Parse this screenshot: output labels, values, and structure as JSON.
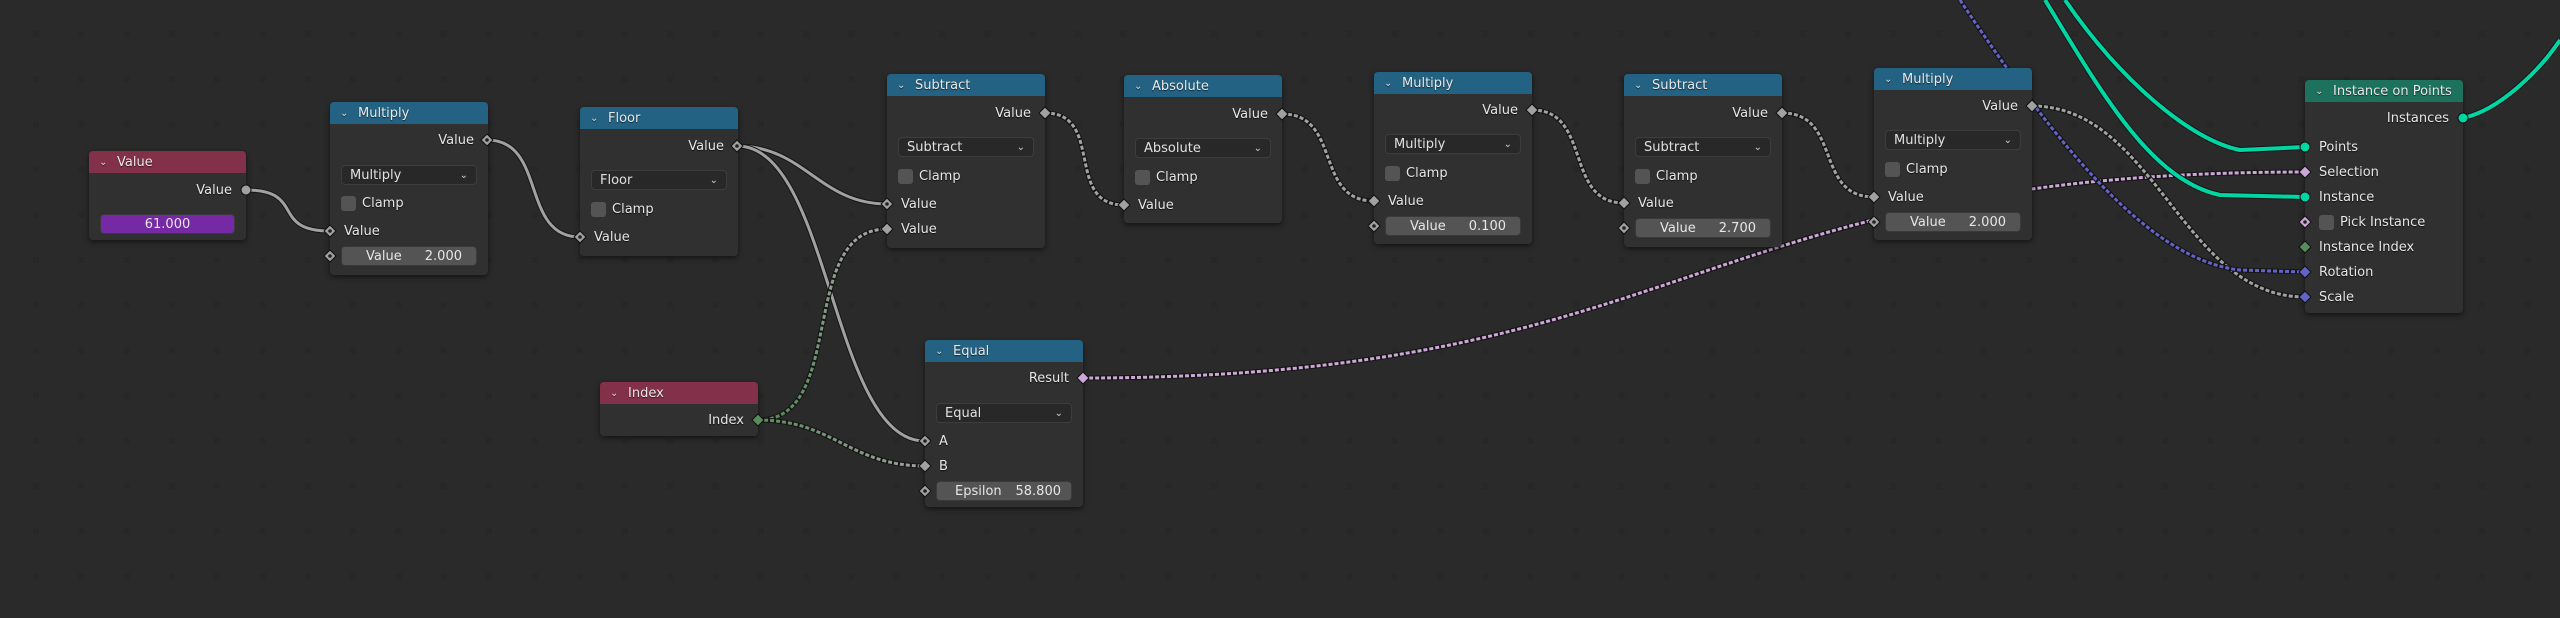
{
  "editor": "Geometry Node Editor",
  "colors": {
    "background": "#1d1d1d",
    "node_body": "#303030",
    "header_input": "#83314a",
    "header_math": "#246283",
    "header_geometry": "#1d725e",
    "socket_float": "#a1a1a1",
    "socket_bool": "#cca6d6",
    "socket_int": "#598c5c",
    "socket_vector": "#6363c7",
    "socket_geometry": "#00d6a3",
    "value_field_purple": "#7629a4"
  },
  "nodes": {
    "value": {
      "title": "Value",
      "output_label": "Value",
      "value": "61.000"
    },
    "multiply1": {
      "title": "Multiply",
      "output_label": "Value",
      "operation": "Multiply",
      "clamp_label": "Clamp",
      "clamp_checked": false,
      "input_label": "Value",
      "field_label": "Value",
      "field_value": "2.000"
    },
    "floor": {
      "title": "Floor",
      "output_label": "Value",
      "operation": "Floor",
      "clamp_label": "Clamp",
      "clamp_checked": false,
      "input_label": "Value"
    },
    "subtract1": {
      "title": "Subtract",
      "output_label": "Value",
      "operation": "Subtract",
      "clamp_label": "Clamp",
      "clamp_checked": false,
      "input1_label": "Value",
      "input2_label": "Value"
    },
    "absolute": {
      "title": "Absolute",
      "output_label": "Value",
      "operation": "Absolute",
      "clamp_label": "Clamp",
      "clamp_checked": false,
      "input_label": "Value"
    },
    "multiply2": {
      "title": "Multiply",
      "output_label": "Value",
      "operation": "Multiply",
      "clamp_label": "Clamp",
      "clamp_checked": false,
      "input_label": "Value",
      "field_label": "Value",
      "field_value": "0.100"
    },
    "subtract2": {
      "title": "Subtract",
      "output_label": "Value",
      "operation": "Subtract",
      "clamp_label": "Clamp",
      "clamp_checked": false,
      "input_label": "Value",
      "field_label": "Value",
      "field_value": "2.700"
    },
    "multiply3": {
      "title": "Multiply",
      "output_label": "Value",
      "operation": "Multiply",
      "clamp_label": "Clamp",
      "clamp_checked": false,
      "input_label": "Value",
      "field_label": "Value",
      "field_value": "2.000"
    },
    "index": {
      "title": "Index",
      "output_label": "Index"
    },
    "equal": {
      "title": "Equal",
      "output_label": "Result",
      "operation": "Equal",
      "input_a_label": "A",
      "input_b_label": "B",
      "field_label": "Epsilon",
      "field_value": "58.800"
    },
    "instance_on_points": {
      "title": "Instance on Points",
      "output_label": "Instances",
      "inputs": {
        "points": "Points",
        "selection": "Selection",
        "instance": "Instance",
        "pick_instance": "Pick Instance",
        "instance_index": "Instance Index",
        "rotation": "Rotation",
        "scale": "Scale"
      },
      "pick_instance_checked": false
    }
  },
  "links": [
    {
      "from": "value.Value",
      "to": "multiply1.Value"
    },
    {
      "from": "multiply1.Value",
      "to": "floor.Value"
    },
    {
      "from": "floor.Value",
      "to": "subtract1.Value[0]"
    },
    {
      "from": "floor.Value",
      "to": "equal.A"
    },
    {
      "from": "index.Index",
      "to": "subtract1.Value[1]"
    },
    {
      "from": "index.Index",
      "to": "equal.B"
    },
    {
      "from": "subtract1.Value",
      "to": "absolute.Value"
    },
    {
      "from": "absolute.Value",
      "to": "multiply2.Value"
    },
    {
      "from": "multiply2.Value",
      "to": "subtract2.Value"
    },
    {
      "from": "subtract2.Value",
      "to": "multiply3.Value"
    },
    {
      "from": "multiply3.Value",
      "to": "instance_on_points.Scale"
    },
    {
      "from": "equal.Result",
      "to": "instance_on_points.Selection"
    },
    {
      "from": "offscreen",
      "to": "instance_on_points.Points"
    },
    {
      "from": "offscreen",
      "to": "instance_on_points.Instance"
    },
    {
      "from": "offscreen",
      "to": "instance_on_points.Rotation"
    },
    {
      "from": "instance_on_points.Instances",
      "to": "offscreen"
    }
  ]
}
